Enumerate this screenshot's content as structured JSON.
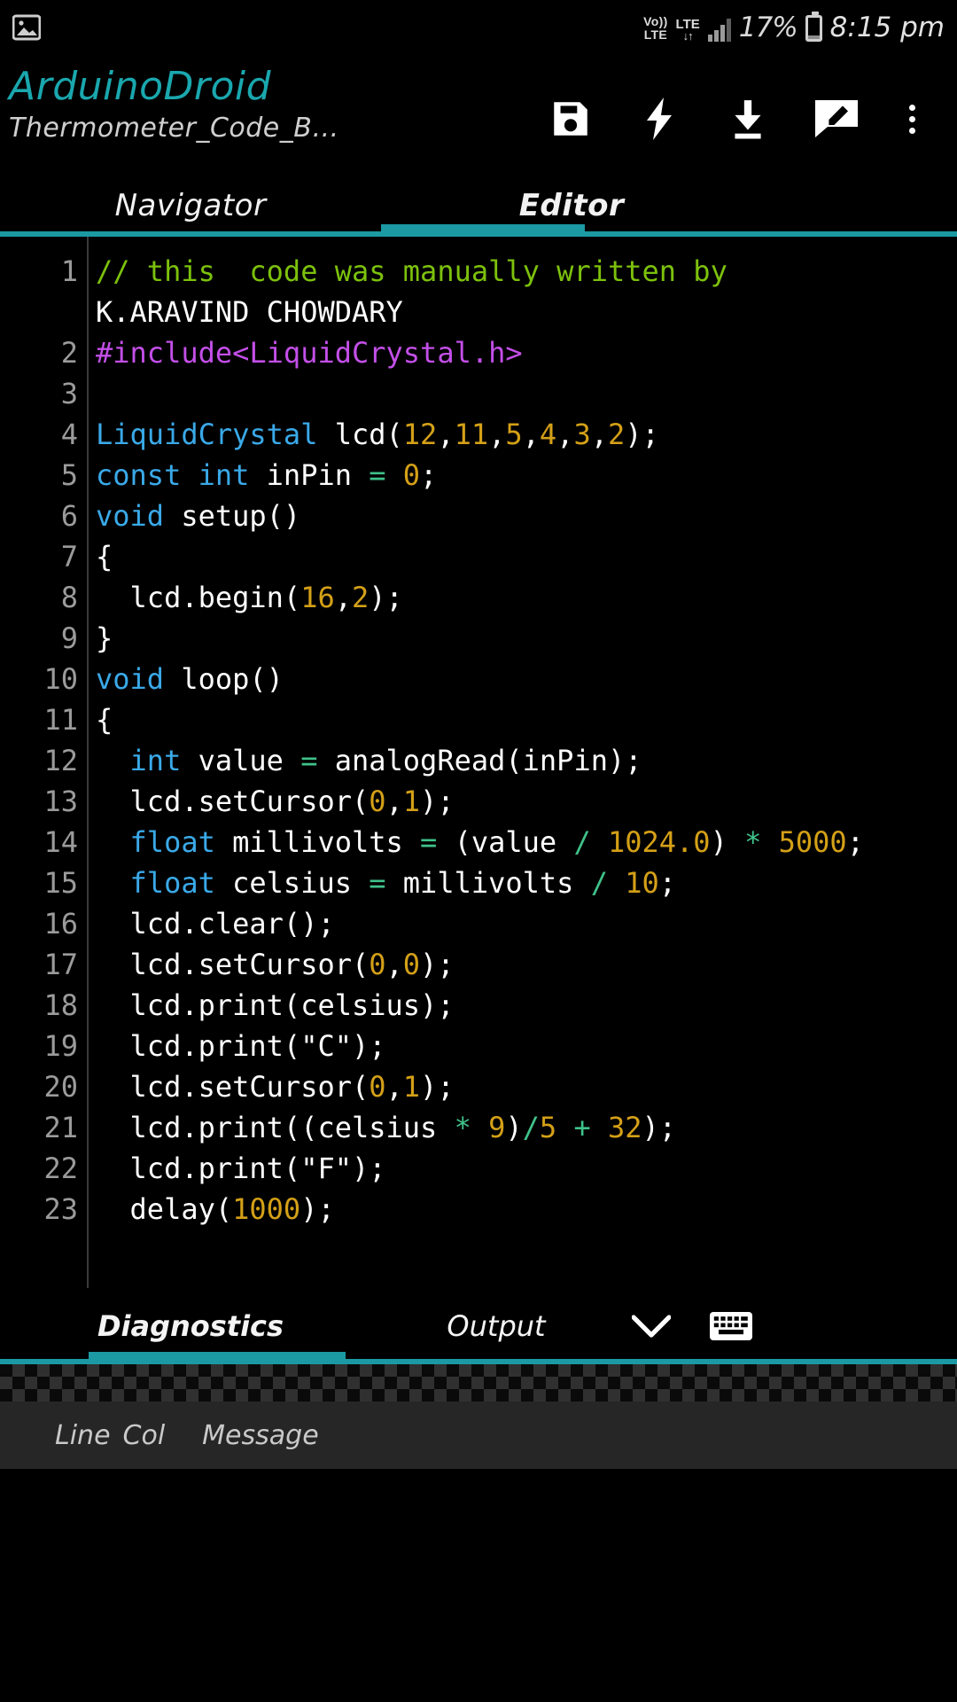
{
  "statusbar": {
    "image_icon": "image-icon",
    "volte_line1": "Vo))",
    "volte_line2": "LTE",
    "lte_label": "LTE",
    "lte_arrows": "↓↑",
    "battery_percent": "17%",
    "time": "8:15 pm"
  },
  "appbar": {
    "title": "ArduinoDroid",
    "subtitle": "Thermometer_Code_B…",
    "actions": [
      {
        "name": "save-button",
        "icon": "floppy-disk-icon",
        "label": "Save"
      },
      {
        "name": "verify-button",
        "icon": "lightning-bolt-icon",
        "label": "Compile"
      },
      {
        "name": "upload-button",
        "icon": "download-arrow-icon",
        "label": "Upload"
      },
      {
        "name": "edit-button",
        "icon": "pencil-note-icon",
        "label": "Edit"
      },
      {
        "name": "overflow-menu-button",
        "icon": "three-dots-vertical-icon",
        "label": "More options"
      }
    ]
  },
  "main_tabs": {
    "items": [
      {
        "label": "Navigator",
        "active": false
      },
      {
        "label": "Editor",
        "active": true
      }
    ],
    "accent_color": "#1b9aa3"
  },
  "editor": {
    "line_numbers": [
      "1",
      "",
      "2",
      "3",
      "4",
      "5",
      "6",
      "7",
      "8",
      "9",
      "10",
      "11",
      "12",
      "13",
      "14",
      "",
      "15",
      "16",
      "17",
      "18",
      "19",
      "20",
      "21",
      "22",
      "23"
    ],
    "lines": [
      {
        "num": "1",
        "text": "// this  code was manually written by"
      },
      {
        "num": "",
        "text": "K.ARAVIND CHOWDARY"
      },
      {
        "num": "2",
        "text": "#include<LiquidCrystal.h>"
      },
      {
        "num": "3",
        "text": ""
      },
      {
        "num": "4",
        "text": "LiquidCrystal lcd(12,11,5,4,3,2);"
      },
      {
        "num": "5",
        "text": "const int inPin = 0;"
      },
      {
        "num": "6",
        "text": "void setup()"
      },
      {
        "num": "7",
        "text": "{"
      },
      {
        "num": "8",
        "text": "  lcd.begin(16,2);"
      },
      {
        "num": "9",
        "text": "}"
      },
      {
        "num": "10",
        "text": "void loop()"
      },
      {
        "num": "11",
        "text": "{"
      },
      {
        "num": "12",
        "text": "  int value = analogRead(inPin);"
      },
      {
        "num": "13",
        "text": "  lcd.setCursor(0,1);"
      },
      {
        "num": "14",
        "text": "  float millivolts = (value / 1024.0) * 5000;"
      },
      {
        "num": "15",
        "text": "  float celsius = millivolts / 10;"
      },
      {
        "num": "16",
        "text": "  lcd.clear();"
      },
      {
        "num": "17",
        "text": "  lcd.setCursor(0,0);"
      },
      {
        "num": "18",
        "text": "  lcd.print(celsius);"
      },
      {
        "num": "19",
        "text": "  lcd.print(\"C\");"
      },
      {
        "num": "20",
        "text": "  lcd.setCursor(0,1);"
      },
      {
        "num": "21",
        "text": "  lcd.print((celsius * 9)/5 + 32);"
      },
      {
        "num": "22",
        "text": "  lcd.print(\"F\");"
      },
      {
        "num": "23",
        "text": "  delay(1000);"
      }
    ],
    "colors": {
      "comment": "#7cc10c",
      "preprocessor": "#c34fe8",
      "keyword": "#3aa9e8",
      "number": "#d4a017",
      "operator": "#3fc28a",
      "text": "#ffffff",
      "background": "#000000",
      "gutter": "#9b9b9b"
    }
  },
  "bottom_panel": {
    "tabs": [
      {
        "label": "Diagnostics",
        "active": true
      },
      {
        "label": "Output",
        "active": false
      }
    ],
    "collapse_icon": "chevron-down-icon",
    "keyboard_icon": "keyboard-icon",
    "table_headers": [
      "Line",
      "Col",
      "Message"
    ],
    "rows": []
  }
}
